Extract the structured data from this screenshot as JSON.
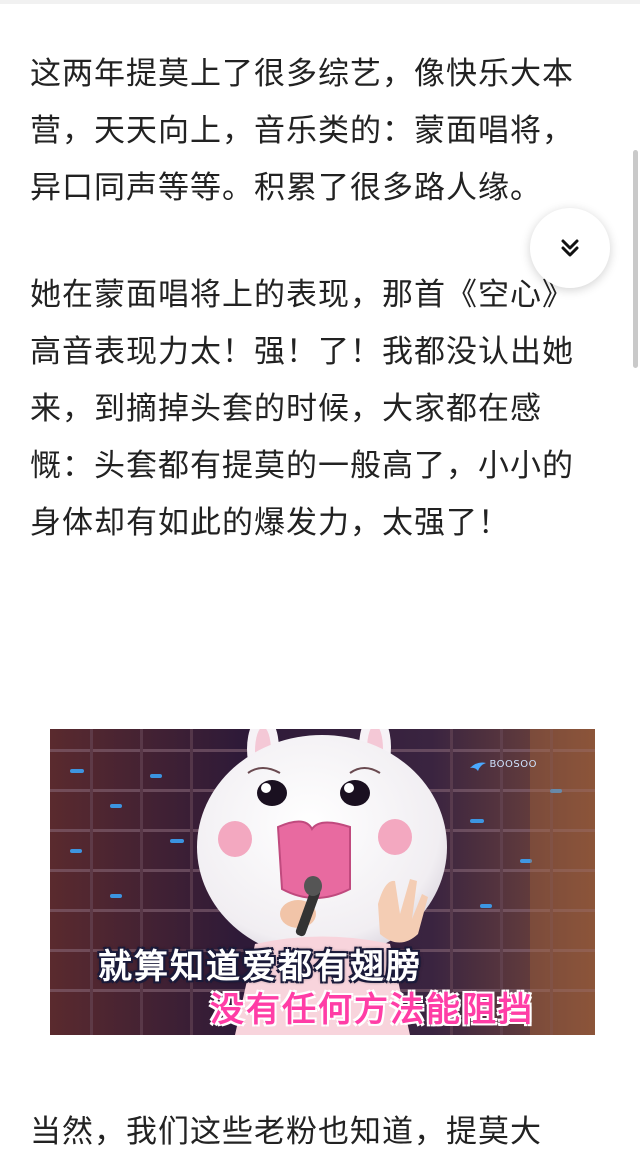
{
  "article": {
    "paragraphs": [
      "这两年提莫上了很多综艺，像快乐大本营，天天向上，音乐类的：蒙面唱将，异口同声等等。积累了很多路人缘。",
      "她在蒙面唱将上的表现，那首《空心》高音表现力太！强！了！我都没认出她来，到摘掉头套的时候，大家都在感慨：头套都有提莫的一般高了，小小的身体却有如此的爆发力，太强了！",
      "当然，我们这些老粉也知道，提莫大"
    ]
  },
  "figure": {
    "watermark": "BOOSOO",
    "lyric_line_1": "就算知道爱都有翅膀",
    "lyric_line_2": "没有任何方法能阻挡"
  },
  "expand_button": {
    "icon": "double-chevron-down-icon"
  },
  "colors": {
    "text": "#222222",
    "lyric_primary": "#ffffff",
    "lyric_secondary": "#ff3da6"
  }
}
